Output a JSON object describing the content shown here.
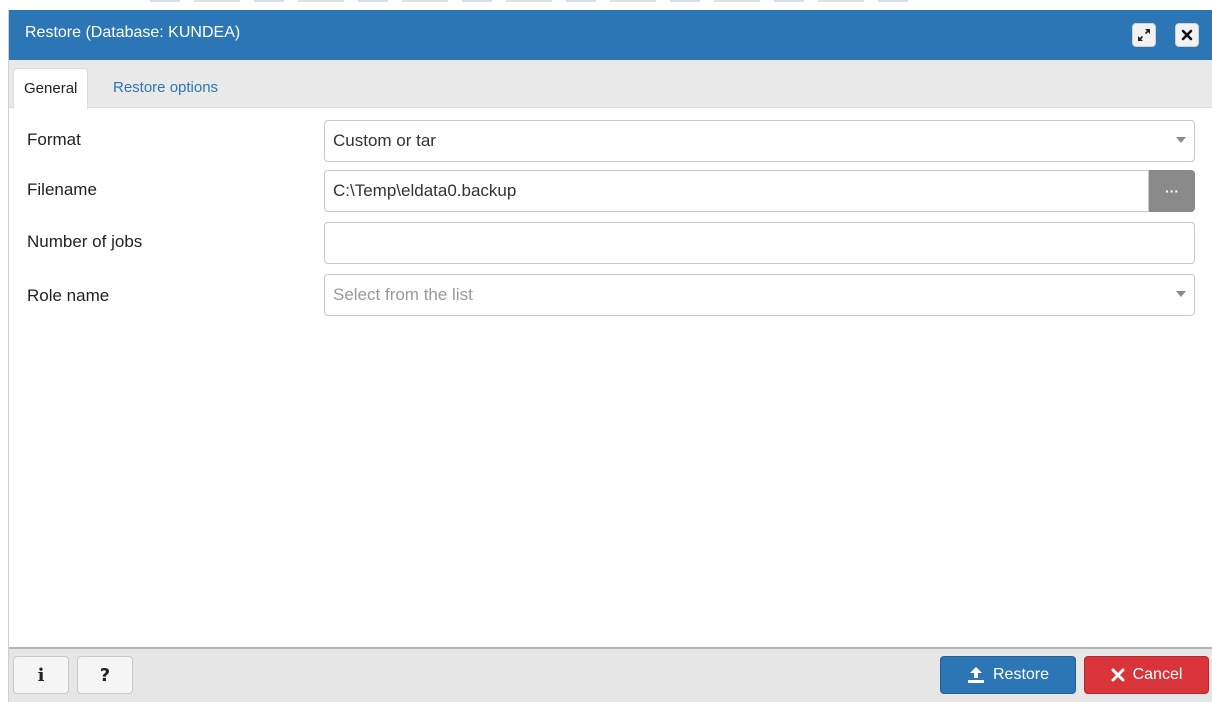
{
  "dialog": {
    "title": "Restore (Database: KUNDEA)",
    "maximize_icon": "expand-icon",
    "close_icon": "close-icon"
  },
  "tabs": [
    {
      "label": "General",
      "active": true
    },
    {
      "label": "Restore options",
      "active": false
    }
  ],
  "form": {
    "format": {
      "label": "Format",
      "value": "Custom or tar"
    },
    "filename": {
      "label": "Filename",
      "value": "C:\\Temp\\eldata0.backup",
      "browse_label": "···"
    },
    "jobs": {
      "label": "Number of jobs",
      "value": ""
    },
    "role": {
      "label": "Role name",
      "placeholder": "Select from the list"
    }
  },
  "footer": {
    "info_label": "i",
    "help_label": "?",
    "restore_label": "Restore",
    "cancel_label": "Cancel"
  },
  "colors": {
    "accent": "#2c76b6",
    "danger": "#d9343a",
    "browse": "#8a8a8a"
  }
}
